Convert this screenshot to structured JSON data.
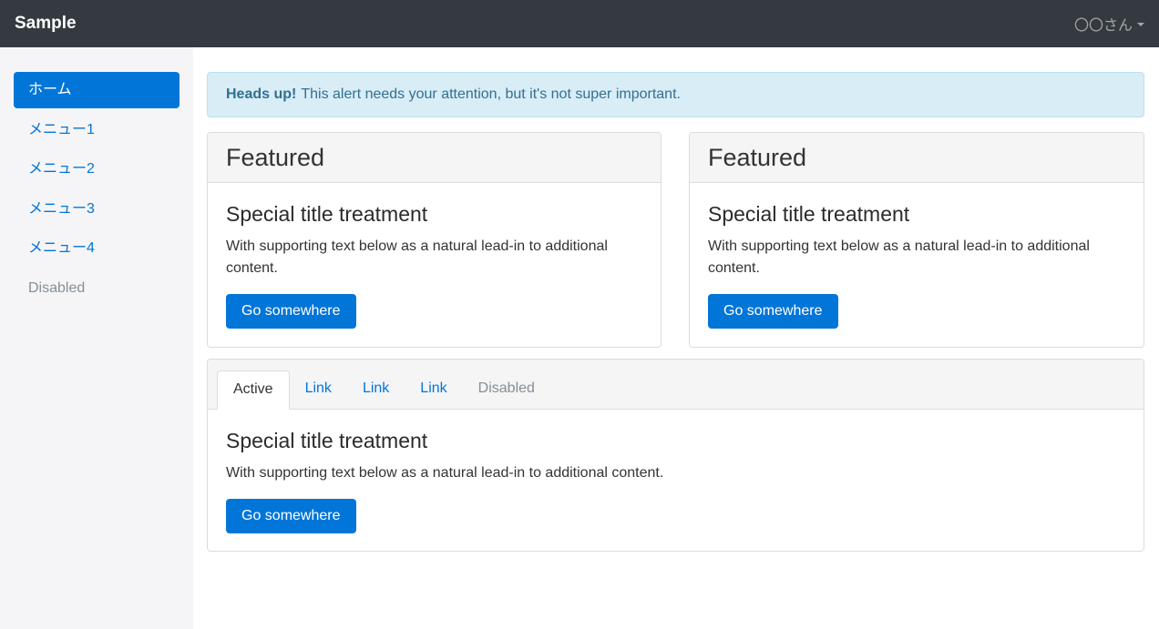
{
  "navbar": {
    "brand": "Sample",
    "user": "〇〇さん"
  },
  "sidebar": {
    "items": [
      {
        "label": "ホーム",
        "state": "active"
      },
      {
        "label": "メニュー1",
        "state": "normal"
      },
      {
        "label": "メニュー2",
        "state": "normal"
      },
      {
        "label": "メニュー3",
        "state": "normal"
      },
      {
        "label": "メニュー4",
        "state": "normal"
      },
      {
        "label": "Disabled",
        "state": "disabled"
      }
    ]
  },
  "alert": {
    "strong": "Heads up!",
    "text": "This alert needs your attention, but it's not super important."
  },
  "cards": [
    {
      "header": "Featured",
      "title": "Special title treatment",
      "text": "With supporting text below as a natural lead-in to additional content.",
      "button": "Go somewhere"
    },
    {
      "header": "Featured",
      "title": "Special title treatment",
      "text": "With supporting text below as a natural lead-in to additional content.",
      "button": "Go somewhere"
    }
  ],
  "tab_card": {
    "tabs": [
      {
        "label": "Active",
        "state": "active"
      },
      {
        "label": "Link",
        "state": "normal"
      },
      {
        "label": "Link",
        "state": "normal"
      },
      {
        "label": "Link",
        "state": "normal"
      },
      {
        "label": "Disabled",
        "state": "disabled"
      }
    ],
    "title": "Special title treatment",
    "text": "With supporting text below as a natural lead-in to additional content.",
    "button": "Go somewhere"
  },
  "colors": {
    "navbar": "#343a40",
    "primary": "#0275d8",
    "alert_bg": "#d9edf7",
    "alert_text": "#31708f",
    "sidebar_bg": "#f5f5f7",
    "muted": "#868e96"
  }
}
